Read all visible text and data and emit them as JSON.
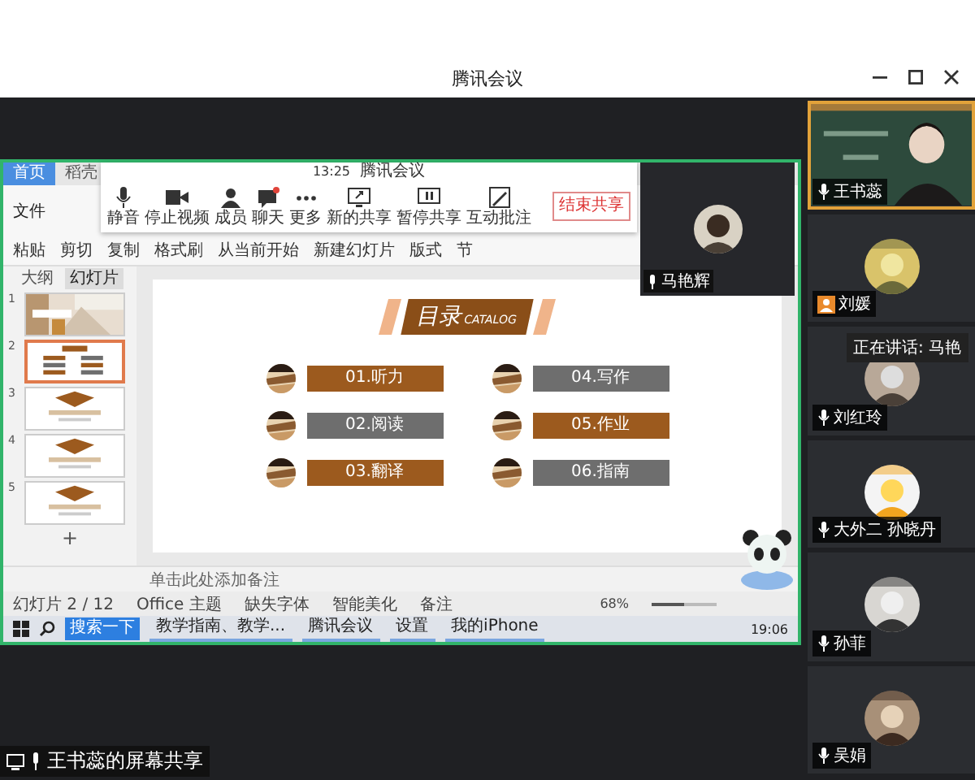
{
  "window": {
    "title": "腾讯会议"
  },
  "meeting_toolbar": {
    "time": "13:25",
    "app_name": "腾讯会议",
    "buttons": [
      {
        "label": "静音",
        "kind": "mic"
      },
      {
        "label": "停止视频",
        "kind": "camera"
      },
      {
        "label": "成员",
        "kind": "members"
      },
      {
        "label": "聊天",
        "kind": "chat"
      },
      {
        "label": "更多",
        "kind": "more"
      },
      {
        "label": "新的共享",
        "kind": "share"
      },
      {
        "label": "暂停共享",
        "kind": "pause"
      },
      {
        "label": "互动批注",
        "kind": "pen"
      }
    ],
    "end_button": "结束共享"
  },
  "speaker_window": {
    "name": "马艳辉"
  },
  "presentation": {
    "app_tabs": [
      {
        "label": "首页",
        "selected": true
      },
      {
        "label": "稻壳",
        "selected": false
      }
    ],
    "file_menu": "文件",
    "ribbon": [
      "粘贴",
      "剪切",
      "复制",
      "格式刷",
      "从当前开始",
      "新建幻灯片",
      "版式",
      "节"
    ],
    "panel_tabs": [
      {
        "label": "大纲",
        "selected": false
      },
      {
        "label": "幻灯片",
        "selected": true
      }
    ],
    "thumbnails": [
      {
        "number": "1",
        "selected": false
      },
      {
        "number": "2",
        "kind": "catalog",
        "selected": true
      },
      {
        "number": "3",
        "kind": "section",
        "selected": false
      },
      {
        "number": "4",
        "kind": "section",
        "selected": false
      },
      {
        "number": "5",
        "kind": "section",
        "selected": false
      }
    ],
    "add_slide": "+",
    "slide": {
      "title": "目录",
      "subtitle": "CATALOG",
      "items": [
        {
          "label": "01.听力",
          "color": "#9c5a1e"
        },
        {
          "label": "04.写作",
          "color": "#6e6e6e"
        },
        {
          "label": "02.阅读",
          "color": "#6e6e6e"
        },
        {
          "label": "05.作业",
          "color": "#9c5a1e"
        },
        {
          "label": "03.翻译",
          "color": "#9c5a1e"
        },
        {
          "label": "06.指南",
          "color": "#6e6e6e"
        }
      ]
    },
    "notes_placeholder": "单击此处添加备注",
    "status_bar": [
      "幻灯片 2 / 12",
      "Office 主题",
      "缺失字体",
      "智能美化",
      "备注"
    ],
    "zoom": {
      "reading": "68%",
      "level": 0.5
    }
  },
  "taskbar": {
    "search": "搜索一下",
    "apps": [
      "教学指南、教学...",
      "腾讯会议",
      "设置",
      "我的iPhone"
    ],
    "clock": "19:06"
  },
  "share_label": "王书蕊的屏幕共享",
  "participants": [
    {
      "name": "王书蕊",
      "kind": "video",
      "audio": true,
      "speaking": true
    },
    {
      "name": "刘媛",
      "kind": "avatar",
      "audio": false,
      "speaking": false
    },
    {
      "name": "刘红玲",
      "kind": "avatar",
      "audio": true,
      "speaking": false
    },
    {
      "name": "大外二 孙晓丹",
      "kind": "avatar",
      "audio": true,
      "speaking": false
    },
    {
      "name": "孙菲",
      "kind": "avatar",
      "audio": true,
      "speaking": false
    },
    {
      "name": "吴娟",
      "kind": "avatar",
      "audio": true,
      "speaking": false
    }
  ],
  "speaking_tooltip": "正在讲话: 马艳"
}
